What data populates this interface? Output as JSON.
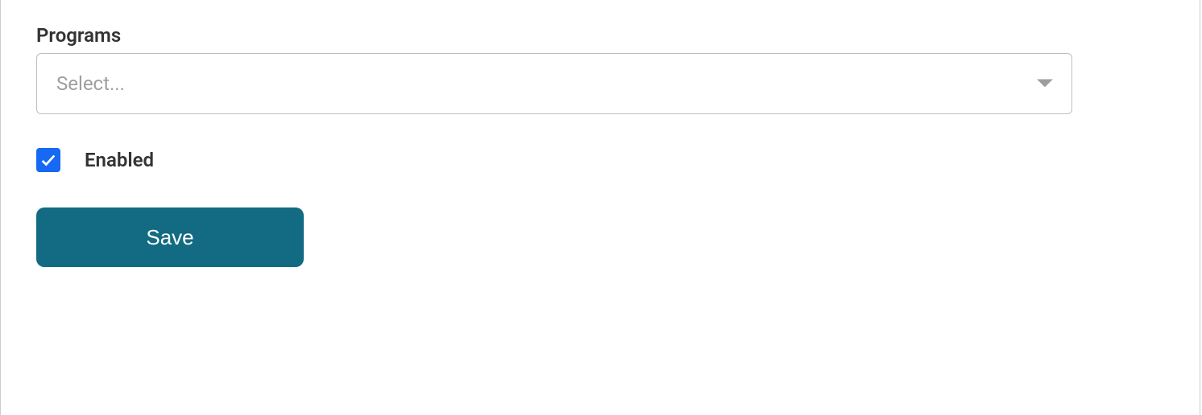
{
  "form": {
    "programs_label": "Programs",
    "programs_placeholder": "Select...",
    "enabled_label": "Enabled",
    "enabled_checked": true,
    "save_label": "Save"
  },
  "colors": {
    "checkbox": "#1669f2",
    "button": "#126b82"
  }
}
